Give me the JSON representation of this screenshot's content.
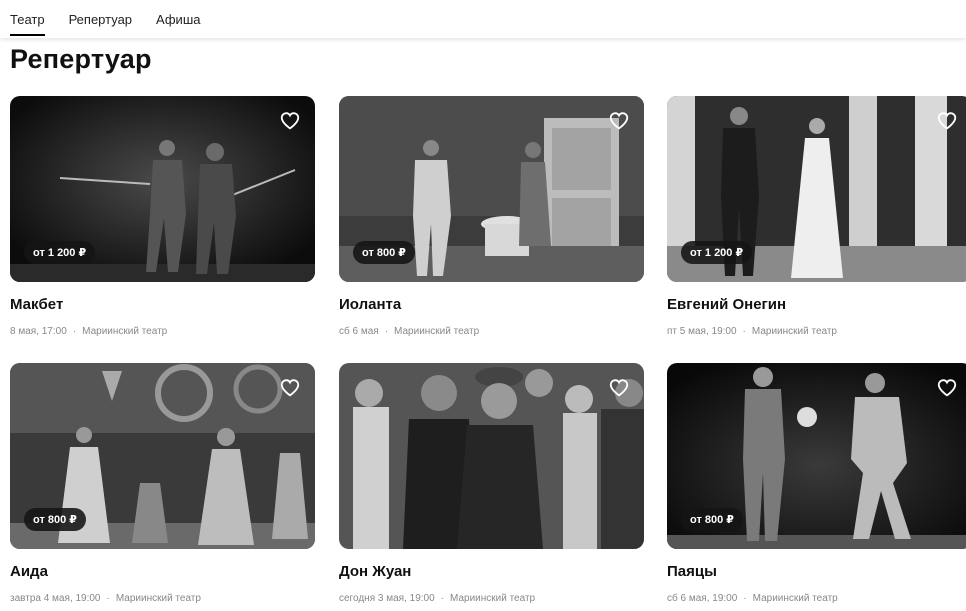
{
  "nav": {
    "tabs": [
      {
        "label": "Театр",
        "active": true
      },
      {
        "label": "Репертуар",
        "active": false
      },
      {
        "label": "Афиша",
        "active": false
      }
    ]
  },
  "page": {
    "title": "Репертуар"
  },
  "cards": [
    {
      "title": "Макбет",
      "price": "от 1 200 ₽",
      "date": "8 мая, 17:00",
      "venue": "Мариинский театр"
    },
    {
      "title": "Иоланта",
      "price": "от 800 ₽",
      "date": "сб 6 мая",
      "venue": "Мариинский театр"
    },
    {
      "title": "Евгений Онегин",
      "price": "от 1 200 ₽",
      "date": "пт 5 мая, 19:00",
      "venue": "Мариинский театр"
    },
    {
      "title": "Аида",
      "price": "от 800 ₽",
      "date": "завтра 4 мая, 19:00",
      "venue": "Мариинский театр"
    },
    {
      "title": "Дон Жуан",
      "price": "",
      "date": "сегодня 3 мая, 19:00",
      "venue": "Мариинский театр"
    },
    {
      "title": "Паяцы",
      "price": "от 800 ₽",
      "date": "сб 6 мая, 19:00",
      "venue": "Мариинский театр"
    }
  ],
  "meta_separator": "·",
  "icons": {
    "favorite": "heart-outline-icon"
  },
  "colors": {
    "price_badge_bg": "#141414",
    "meta_text": "#888888",
    "active_tab_underline": "#000000"
  }
}
